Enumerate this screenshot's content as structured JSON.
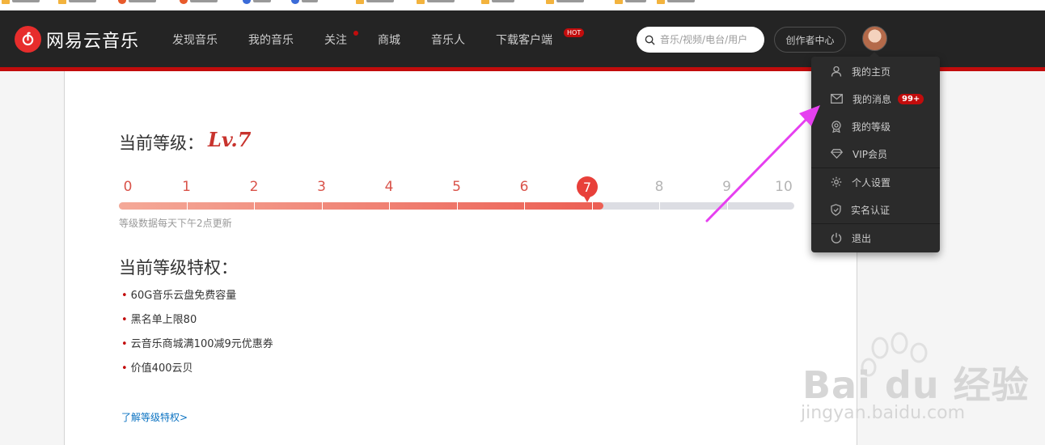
{
  "header": {
    "logo_text": "网易云音乐",
    "nav": [
      {
        "label": "发现音乐"
      },
      {
        "label": "我的音乐"
      },
      {
        "label": "关注"
      },
      {
        "label": "商城"
      },
      {
        "label": "音乐人"
      },
      {
        "label": "下载客户端"
      }
    ],
    "hot_badge": "HOT",
    "search_placeholder": "音乐/视频/电台/用户",
    "creator_center": "创作者中心"
  },
  "user_menu": {
    "items": [
      {
        "label": "我的主页",
        "icon": "user-icon"
      },
      {
        "label": "我的消息",
        "icon": "mail-icon",
        "badge": "99+"
      },
      {
        "label": "我的等级",
        "icon": "medal-icon"
      },
      {
        "label": "VIP会员",
        "icon": "diamond-icon"
      },
      {
        "label": "个人设置",
        "icon": "gear-icon"
      },
      {
        "label": "实名认证",
        "icon": "shield-check-icon"
      },
      {
        "label": "退出",
        "icon": "power-icon"
      }
    ]
  },
  "level": {
    "title": "当前等级：",
    "value": "Lv.7",
    "current": 7,
    "max": 10,
    "ticks": [
      "0",
      "1",
      "2",
      "3",
      "4",
      "5",
      "6",
      "7",
      "8",
      "9",
      "10"
    ],
    "update_note": "等级数据每天下午2点更新"
  },
  "privileges": {
    "title": "当前等级特权：",
    "items": [
      "60G音乐云盘免费容量",
      "黑名单上限80",
      "云音乐商城满100减9元优惠券",
      "价值400云贝"
    ],
    "learn_more": "了解等级特权>"
  },
  "watermark": {
    "brand": "Bai du 经验",
    "url": "jingyan.baidu.com"
  },
  "colors": {
    "nav_bg": "#242424",
    "accent_red": "#c20c0c",
    "level_red": "#e8403a",
    "arrow_magenta": "#e640f0"
  }
}
